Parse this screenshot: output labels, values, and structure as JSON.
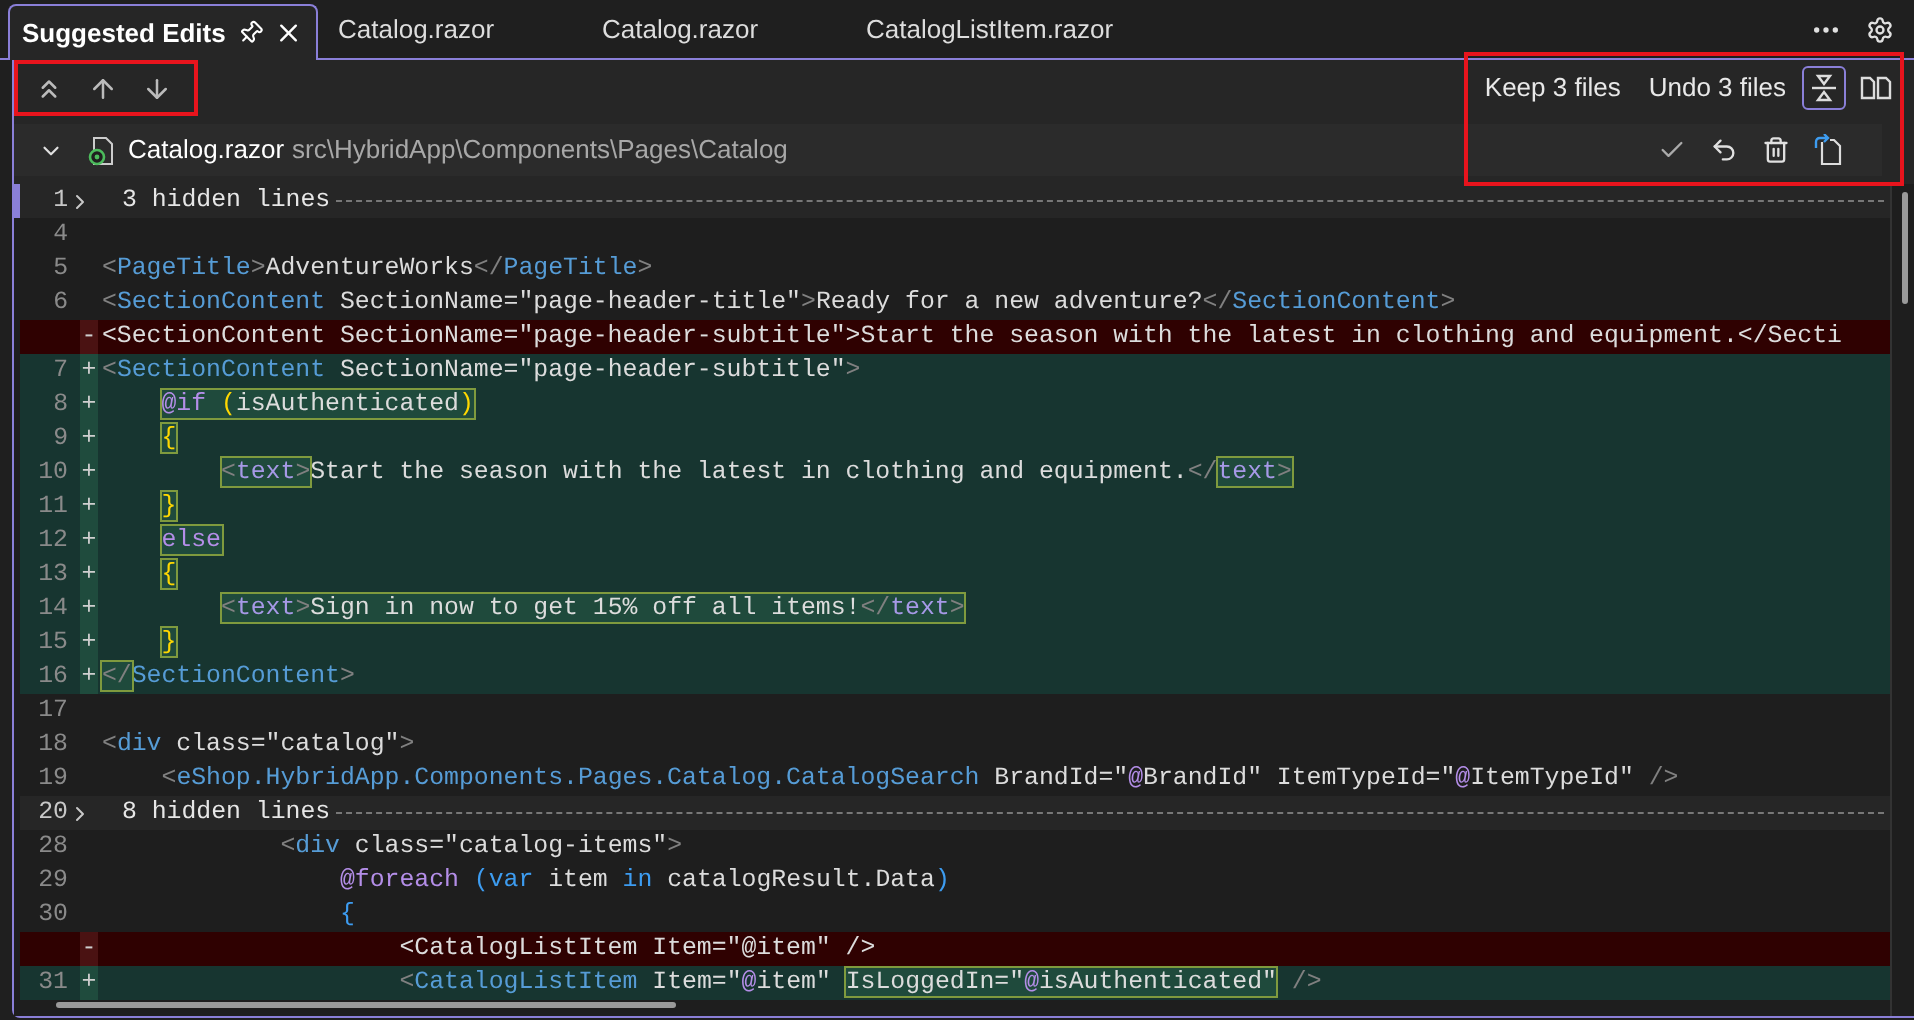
{
  "tabs": [
    {
      "label": "Suggested Edits",
      "selected": true,
      "pinned": true
    },
    {
      "label": "Catalog.razor",
      "selected": false,
      "pinned": false
    },
    {
      "label": "Catalog.razor",
      "selected": false,
      "pinned": false
    },
    {
      "label": "CatalogListItem.razor",
      "selected": false,
      "pinned": false
    }
  ],
  "toolbar": {
    "keep_label": "Keep 3 files",
    "undo_label": "Undo 3 files",
    "view_modes": [
      {
        "kind": "inline",
        "selected": true
      },
      {
        "kind": "side-by-side",
        "selected": false
      }
    ]
  },
  "file": {
    "name": "Catalog.razor",
    "path": "src\\HybridApp\\Components\\Pages\\Catalog",
    "expanded": true
  },
  "lines": [
    {
      "kind": "fold",
      "number": "1",
      "label": "3 hidden lines"
    },
    {
      "kind": "context",
      "number": "4"
    },
    {
      "kind": "context",
      "number": "5",
      "tokens": [
        {
          "t": "<",
          "kind": "punct"
        },
        {
          "t": "PageTitle",
          "kind": "tag"
        },
        {
          "t": ">",
          "kind": "punct"
        },
        {
          "t": "AdventureWorks",
          "kind": "text"
        },
        {
          "t": "</",
          "kind": "punct"
        },
        {
          "t": "PageTitle",
          "kind": "tag"
        },
        {
          "t": ">",
          "kind": "punct"
        }
      ]
    },
    {
      "kind": "context",
      "number": "6",
      "tokens": [
        {
          "t": "<",
          "kind": "punct"
        },
        {
          "t": "SectionContent",
          "kind": "tag"
        },
        {
          "t": " SectionName=\"page-header-title\"",
          "kind": "text"
        },
        {
          "t": ">",
          "kind": "punct"
        },
        {
          "t": "Ready for a new adventure?",
          "kind": "text"
        },
        {
          "t": "</",
          "kind": "punct"
        },
        {
          "t": "SectionContent",
          "kind": "tag"
        },
        {
          "t": ">",
          "kind": "punct"
        }
      ]
    },
    {
      "kind": "removed",
      "marker": "-",
      "tokens": [
        {
          "t": "<SectionContent SectionName=\"page-header-subtitle\">Start the season with the latest in clothing and equipment.</Secti",
          "kind": "text"
        }
      ]
    },
    {
      "kind": "added",
      "number": "7",
      "marker": "+",
      "tokens": [
        {
          "t": "<",
          "kind": "punct"
        },
        {
          "t": "SectionContent",
          "kind": "tag"
        },
        {
          "t": " SectionName=\"page-header-subtitle\"",
          "kind": "text"
        },
        {
          "t": ">",
          "kind": "punct"
        }
      ]
    },
    {
      "kind": "added",
      "number": "8",
      "marker": "+",
      "tokens": [
        {
          "t": "    @if",
          "kind": "keyword",
          "boxed": true
        },
        {
          "t": " (",
          "kind": "brace",
          "boxed": true
        },
        {
          "t": "isAuthenticated",
          "kind": "text",
          "boxed": true
        },
        {
          "t": ")",
          "kind": "brace",
          "boxed": true
        }
      ]
    },
    {
      "kind": "added",
      "number": "9",
      "marker": "+",
      "tokens": [
        {
          "t": "    {",
          "kind": "brace",
          "boxed": true
        }
      ]
    },
    {
      "kind": "added",
      "number": "10",
      "marker": "+",
      "tokens": [
        {
          "t": "        <",
          "kind": "punct",
          "boxed": true
        },
        {
          "t": "text",
          "kind": "razor",
          "boxed": true
        },
        {
          "t": ">",
          "kind": "punct",
          "boxed": true
        },
        {
          "t": "Start the season with the latest in clothing and equipment.",
          "kind": "text"
        },
        {
          "t": "</",
          "kind": "punct"
        },
        {
          "t": "text",
          "kind": "razor",
          "boxed": true
        },
        {
          "t": ">",
          "kind": "punct",
          "boxed": true
        }
      ]
    },
    {
      "kind": "added",
      "number": "11",
      "marker": "+",
      "tokens": [
        {
          "t": "    }",
          "kind": "brace",
          "boxed": true
        }
      ]
    },
    {
      "kind": "added",
      "number": "12",
      "marker": "+",
      "tokens": [
        {
          "t": "    else",
          "kind": "keyword",
          "boxed": true
        }
      ]
    },
    {
      "kind": "added",
      "number": "13",
      "marker": "+",
      "tokens": [
        {
          "t": "    {",
          "kind": "brace",
          "boxed": true
        }
      ]
    },
    {
      "kind": "added",
      "number": "14",
      "marker": "+",
      "tokens": [
        {
          "t": "        <",
          "kind": "punct",
          "boxed": true
        },
        {
          "t": "text",
          "kind": "razor",
          "boxed": true
        },
        {
          "t": ">",
          "kind": "punct",
          "boxed": true
        },
        {
          "t": "Sign in now to get 15% off all items!",
          "kind": "text",
          "boxed": true
        },
        {
          "t": "</",
          "kind": "punct",
          "boxed": true
        },
        {
          "t": "text",
          "kind": "razor",
          "boxed": true
        },
        {
          "t": ">",
          "kind": "punct",
          "boxed": true
        }
      ]
    },
    {
      "kind": "added",
      "number": "15",
      "marker": "+",
      "tokens": [
        {
          "t": "    }",
          "kind": "brace",
          "boxed": true
        }
      ]
    },
    {
      "kind": "added",
      "number": "16",
      "marker": "+",
      "tokens": [
        {
          "t": "</",
          "kind": "punct",
          "boxed": true
        },
        {
          "t": "SectionContent",
          "kind": "tag"
        },
        {
          "t": ">",
          "kind": "punct"
        }
      ]
    },
    {
      "kind": "context",
      "number": "17"
    },
    {
      "kind": "context",
      "number": "18",
      "tokens": [
        {
          "t": "<",
          "kind": "punct"
        },
        {
          "t": "div",
          "kind": "tag"
        },
        {
          "t": " class=\"catalog\"",
          "kind": "text"
        },
        {
          "t": ">",
          "kind": "punct"
        }
      ]
    },
    {
      "kind": "context",
      "number": "19",
      "tokens": [
        {
          "t": "    <",
          "kind": "punct"
        },
        {
          "t": "eShop.HybridApp.Components.Pages.Catalog.CatalogSearch",
          "kind": "tag"
        },
        {
          "t": " BrandId=\"",
          "kind": "text"
        },
        {
          "t": "@",
          "kind": "keyword"
        },
        {
          "t": "BrandId\" ItemTypeId=\"",
          "kind": "text"
        },
        {
          "t": "@",
          "kind": "keyword"
        },
        {
          "t": "ItemTypeId\"",
          "kind": "text"
        },
        {
          "t": " />",
          "kind": "punct"
        }
      ]
    },
    {
      "kind": "fold",
      "number": "20",
      "label": "8 hidden lines"
    },
    {
      "kind": "context",
      "number": "28",
      "tokens": [
        {
          "t": "            <",
          "kind": "punct"
        },
        {
          "t": "div",
          "kind": "tag"
        },
        {
          "t": " class=\"catalog-items\"",
          "kind": "text"
        },
        {
          "t": ">",
          "kind": "punct"
        }
      ]
    },
    {
      "kind": "context",
      "number": "29",
      "tokens": [
        {
          "t": "                @foreach",
          "kind": "keyword"
        },
        {
          "t": " (var",
          "kind": "control"
        },
        {
          "t": " item ",
          "kind": "text"
        },
        {
          "t": "in",
          "kind": "control"
        },
        {
          "t": " catalogResult.Data",
          "kind": "text"
        },
        {
          "t": ")",
          "kind": "control"
        }
      ]
    },
    {
      "kind": "context",
      "number": "30",
      "tokens": [
        {
          "t": "                {",
          "kind": "control"
        }
      ]
    },
    {
      "kind": "removed",
      "marker": "-",
      "tokens": [
        {
          "t": "                    <CatalogListItem Item=\"@item\" />",
          "kind": "text"
        }
      ]
    },
    {
      "kind": "added",
      "number": "31",
      "marker": "+",
      "tokens": [
        {
          "t": "                    <",
          "kind": "punct"
        },
        {
          "t": "CatalogListItem",
          "kind": "tag"
        },
        {
          "t": " Item=\"",
          "kind": "text"
        },
        {
          "t": "@",
          "kind": "keyword"
        },
        {
          "t": "item\" ",
          "kind": "text"
        },
        {
          "t": "IsLoggedIn=\"",
          "kind": "text",
          "boxed": true
        },
        {
          "t": "@",
          "kind": "keyword",
          "boxed": true
        },
        {
          "t": "isAuthenticated\"",
          "kind": "text",
          "boxed": true
        },
        {
          "t": " />",
          "kind": "punct"
        }
      ]
    }
  ]
}
